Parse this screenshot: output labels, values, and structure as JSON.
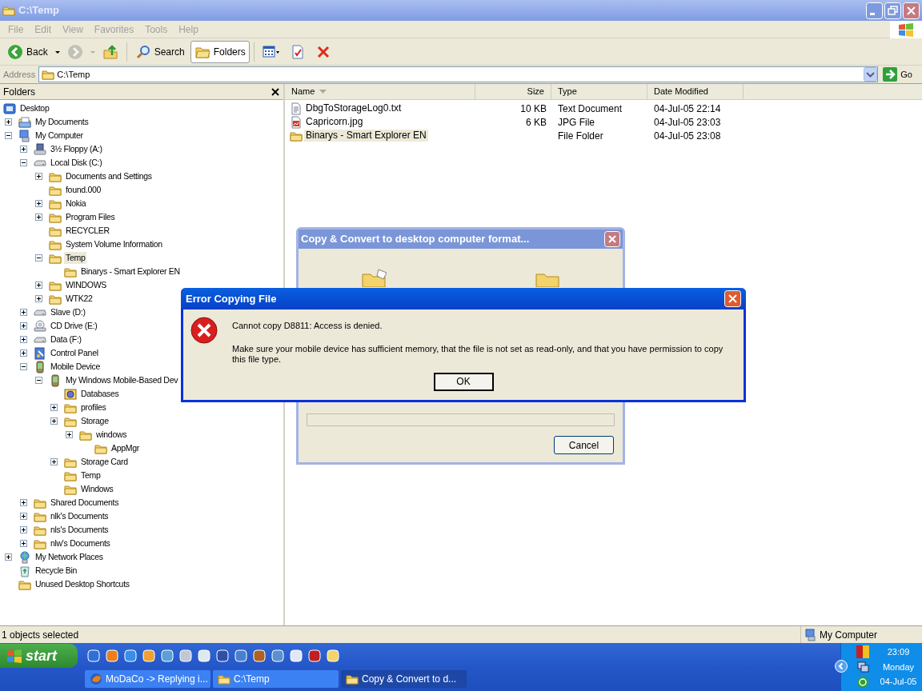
{
  "window": {
    "title": "C:\\Temp"
  },
  "menu": [
    "File",
    "Edit",
    "View",
    "Favorites",
    "Tools",
    "Help"
  ],
  "toolbar": [
    {
      "kind": "back",
      "label": "Back",
      "disabled": false,
      "pressed": false
    },
    {
      "kind": "forward",
      "disabled": true,
      "pressed": false
    },
    {
      "kind": "up",
      "disabled": false,
      "pressed": false
    },
    {
      "kind": "search",
      "label": "Search",
      "disabled": false,
      "pressed": false
    },
    {
      "kind": "folders",
      "label": "Folders",
      "disabled": false,
      "pressed": true
    },
    {
      "kind": "views",
      "disabled": false,
      "pressed": false
    },
    {
      "kind": "properties",
      "disabled": false,
      "pressed": false
    },
    {
      "kind": "delete",
      "disabled": false,
      "pressed": false
    }
  ],
  "address": {
    "label": "Address",
    "value": "C:\\Temp",
    "go": "Go"
  },
  "folders_pane": {
    "title": "Folders",
    "tree": [
      {
        "label": "Desktop",
        "kind": "desktop",
        "selected": false,
        "children": [
          {
            "label": "My Documents",
            "kind": "documents",
            "expanded": false,
            "selected": false
          },
          {
            "label": "My Computer",
            "kind": "computer",
            "expanded": true,
            "selected": false,
            "children": [
              {
                "label": "3½ Floppy (A:)",
                "kind": "floppy",
                "expanded": false,
                "selected": false
              },
              {
                "label": "Local Disk (C:)",
                "kind": "disk",
                "expanded": true,
                "selected": false,
                "children": [
                  {
                    "label": "Documents and Settings",
                    "kind": "folder",
                    "expanded": false,
                    "selected": false
                  },
                  {
                    "label": "found.000",
                    "kind": "folder",
                    "selected": false
                  },
                  {
                    "label": "Nokia",
                    "kind": "folder",
                    "expanded": false,
                    "selected": false
                  },
                  {
                    "label": "Program Files",
                    "kind": "folder",
                    "expanded": false,
                    "selected": false
                  },
                  {
                    "label": "RECYCLER",
                    "kind": "folder",
                    "selected": false
                  },
                  {
                    "label": "System Volume Information",
                    "kind": "folder",
                    "selected": false
                  },
                  {
                    "label": "Temp",
                    "kind": "folder",
                    "expanded": true,
                    "selected": true,
                    "children": [
                      {
                        "label": "Binarys - Smart Explorer EN",
                        "kind": "folder",
                        "selected": false
                      }
                    ]
                  },
                  {
                    "label": "WINDOWS",
                    "kind": "folder",
                    "expanded": false,
                    "selected": false
                  },
                  {
                    "label": "WTK22",
                    "kind": "folder",
                    "expanded": false,
                    "selected": false
                  }
                ]
              },
              {
                "label": "Slave (D:)",
                "kind": "disk",
                "expanded": false,
                "selected": false
              },
              {
                "label": "CD Drive (E:)",
                "kind": "cd",
                "expanded": false,
                "selected": false
              },
              {
                "label": "Data (F:)",
                "kind": "disk",
                "expanded": false,
                "selected": false
              },
              {
                "label": "Control Panel",
                "kind": "control",
                "expanded": false,
                "selected": false
              },
              {
                "label": "Mobile Device",
                "kind": "mobile",
                "expanded": true,
                "selected": false,
                "children": [
                  {
                    "label": "My Windows Mobile-Based Dev",
                    "kind": "mobile",
                    "expanded": true,
                    "selected": false,
                    "children": [
                      {
                        "label": "Databases",
                        "kind": "database",
                        "selected": false
                      },
                      {
                        "label": "profiles",
                        "kind": "folder",
                        "expanded": false,
                        "selected": false
                      },
                      {
                        "label": "Storage",
                        "kind": "folder",
                        "expanded": false,
                        "selected": false,
                        "children": [
                          {
                            "label": "windows",
                            "kind": "folder",
                            "expanded": false,
                            "selected": false,
                            "children": [
                              {
                                "label": "AppMgr",
                                "kind": "folder",
                                "selected": false
                              }
                            ]
                          }
                        ]
                      },
                      {
                        "label": "Storage Card",
                        "kind": "folder",
                        "expanded": false,
                        "selected": false
                      },
                      {
                        "label": "Temp",
                        "kind": "folder",
                        "selected": false
                      },
                      {
                        "label": "Windows",
                        "kind": "folder",
                        "selected": false
                      }
                    ]
                  }
                ]
              },
              {
                "label": "Shared Documents",
                "kind": "folder",
                "expanded": false,
                "selected": false
              },
              {
                "label": "nlk's Documents",
                "kind": "folder",
                "expanded": false,
                "selected": false
              },
              {
                "label": "nls's Documents",
                "kind": "folder",
                "expanded": false,
                "selected": false
              },
              {
                "label": "nlw's Documents",
                "kind": "folder",
                "expanded": false,
                "selected": false
              }
            ]
          },
          {
            "label": "My Network Places",
            "kind": "network",
            "expanded": false,
            "selected": false
          },
          {
            "label": "Recycle Bin",
            "kind": "recycle",
            "selected": false
          },
          {
            "label": "Unused Desktop Shortcuts",
            "kind": "folder",
            "selected": false
          }
        ]
      }
    ]
  },
  "file_list": {
    "columns": [
      {
        "label": "Name",
        "sorted": true
      },
      {
        "label": "Size",
        "sorted": false
      },
      {
        "label": "Type",
        "sorted": false
      },
      {
        "label": "Date Modified",
        "sorted": false
      }
    ],
    "rows": [
      {
        "kind": "text",
        "name": "DbgToStorageLog0.txt",
        "size": "10 KB",
        "type": "Text Document",
        "date": "04-Jul-05 22:14",
        "selected": false
      },
      {
        "kind": "image",
        "name": "Capricorn.jpg",
        "size": "6 KB",
        "type": "JPG File",
        "date": "04-Jul-05 23:03",
        "selected": false
      },
      {
        "kind": "folder",
        "name": "Binarys - Smart Explorer EN",
        "type": "File Folder",
        "date": "04-Jul-05 23:08",
        "selected": true
      }
    ]
  },
  "status_bar": {
    "text": "1 objects selected",
    "zone": "My Computer"
  },
  "copy_dialog": {
    "title": "Copy & Convert to desktop computer format...",
    "active": false,
    "level": 0,
    "button": "Cancel"
  },
  "error_dialog": {
    "title": "Error Copying File",
    "active": true,
    "message": "Cannot copy D8811: Access is denied.",
    "detail": "Make sure your mobile device has sufficient memory, that the file is not set as read-only, and that you have permission to copy this file type.",
    "button": "OK"
  },
  "taskbar": {
    "start": "start",
    "tasks": [
      {
        "label": "MoDaCo -> Replying i...",
        "kind": "browser",
        "selected": false
      },
      {
        "label": "C:\\Temp",
        "kind": "folder",
        "selected": false
      },
      {
        "label": "Copy & Convert to d...",
        "kind": "folder",
        "selected": true
      }
    ],
    "clock": [
      "23:09",
      "Monday",
      "04-Jul-05"
    ]
  }
}
